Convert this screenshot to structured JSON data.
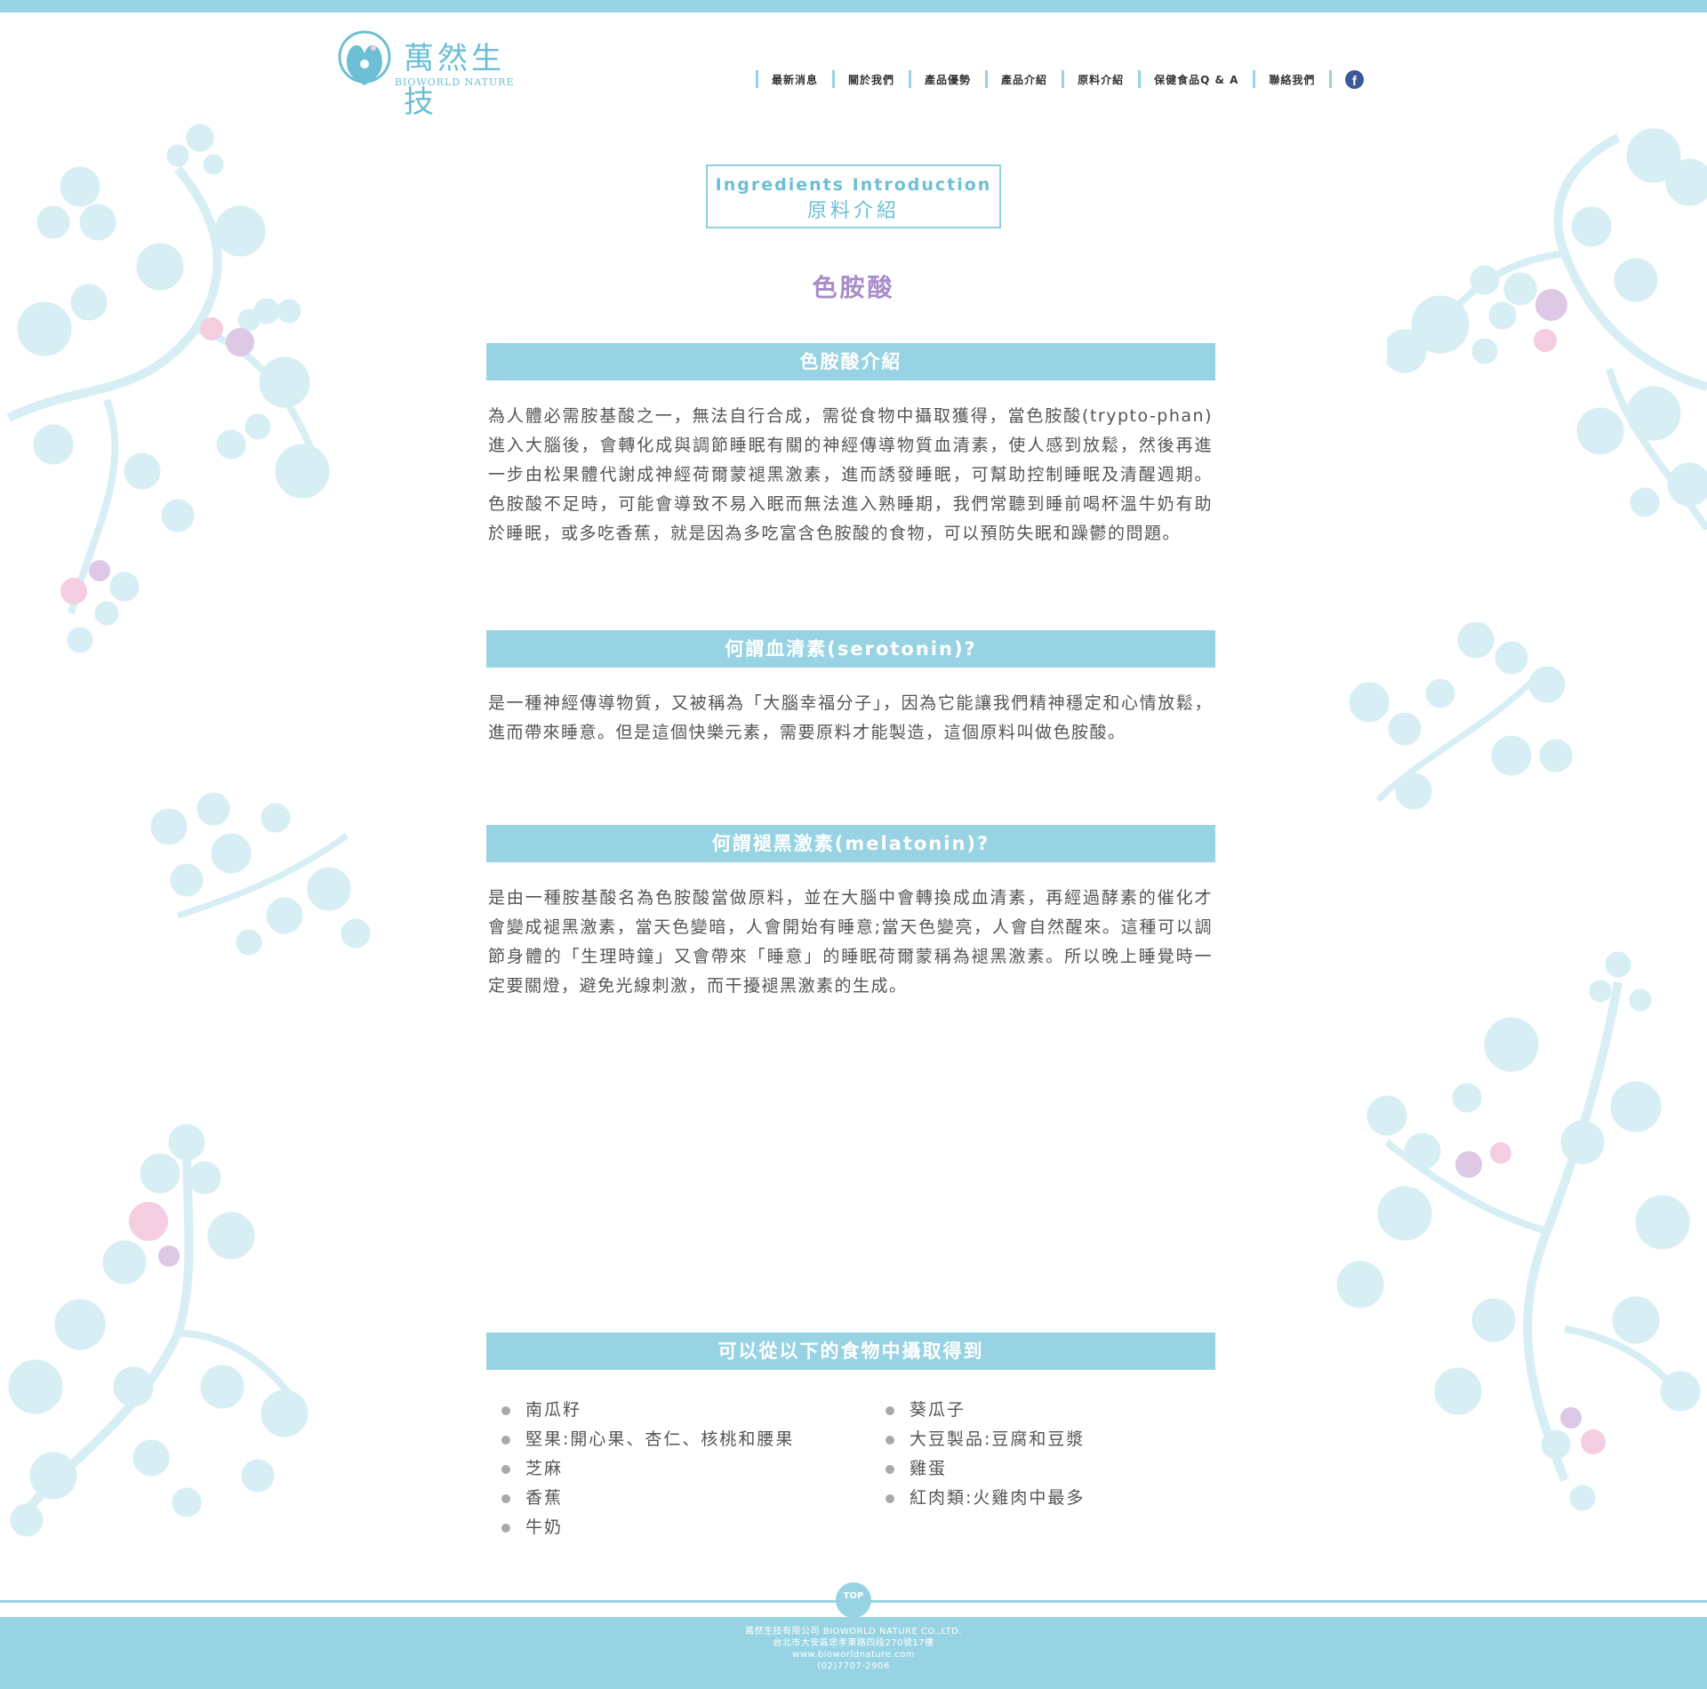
{
  "header": {
    "logo_cn": "萬然生技",
    "logo_en": "BIOWORLD NATURE",
    "nav": [
      {
        "label": "最新消息"
      },
      {
        "label": "關於我們"
      },
      {
        "label": "產品優勢"
      },
      {
        "label": "產品介紹"
      },
      {
        "label": "原料介紹"
      },
      {
        "label": "保健食品Q & A"
      },
      {
        "label": "聯絡我們"
      }
    ],
    "facebook_icon": "facebook-icon"
  },
  "title_box": {
    "en": "Ingredients Introduction",
    "cn": "原料介紹"
  },
  "page_title": "色胺酸",
  "sections": [
    {
      "heading": "色胺酸介紹",
      "body": "為人體必需胺基酸之一，無法自行合成，需從食物中攝取獲得，當色胺酸(trypto-phan)進入大腦後，會轉化成與調節睡眠有關的神經傳導物質血清素，使人感到放鬆，然後再進一步由松果體代謝成神經荷爾蒙褪黑激素，進而誘發睡眠，可幫助控制睡眠及清醒週期。色胺酸不足時，可能會導致不易入眠而無法進入熟睡期，我們常聽到睡前喝杯溫牛奶有助於睡眠，或多吃香蕉，就是因為多吃富含色胺酸的食物，可以預防失眠和躁鬱的問題。"
    },
    {
      "heading": "何謂血清素(serotonin)?",
      "body": "是一種神經傳導物質，又被稱為「大腦幸福分子」，因為它能讓我們精神穩定和心情放鬆，進而帶來睡意。但是這個快樂元素，需要原料才能製造，這個原料叫做色胺酸。"
    },
    {
      "heading": "何謂褪黑激素(melatonin)?",
      "body": "是由一種胺基酸名為色胺酸當做原料，並在大腦中會轉換成血清素，再經過酵素的催化才會變成褪黑激素，當天色變暗，人會開始有睡意;當天色變亮，人會自然醒來。這種可以調節身體的「生理時鐘」又會帶來「睡意」的睡眠荷爾蒙稱為褪黑激素。所以晚上睡覺時一定要關燈，避免光線刺激，而干擾褪黑激素的生成。"
    },
    {
      "heading": "可以從以下的食物中攝取得到"
    }
  ],
  "foods_left": [
    "南瓜籽",
    "堅果:開心果、杏仁、核桃和腰果",
    "芝麻",
    "香蕉",
    "牛奶"
  ],
  "foods_right": [
    "葵瓜子",
    "大豆製品:豆腐和豆漿",
    "雞蛋",
    "紅肉類:火雞肉中最多"
  ],
  "top_button": "TOP",
  "footer": {
    "company": "萬然生技有限公司 BIOWORLD NATURE CO.,LTD.",
    "address": "台北市大安區忠孝東路四段270號17樓",
    "website": "www.bioworldnature.com",
    "phone": "(02)7707-2906"
  },
  "colors": {
    "accent": "#97d3e2",
    "title_purple": "#a88dc9",
    "deco_blue": "#d6eef4",
    "deco_pink": "#f4cde0",
    "deco_lilac": "#ddc8e6"
  }
}
